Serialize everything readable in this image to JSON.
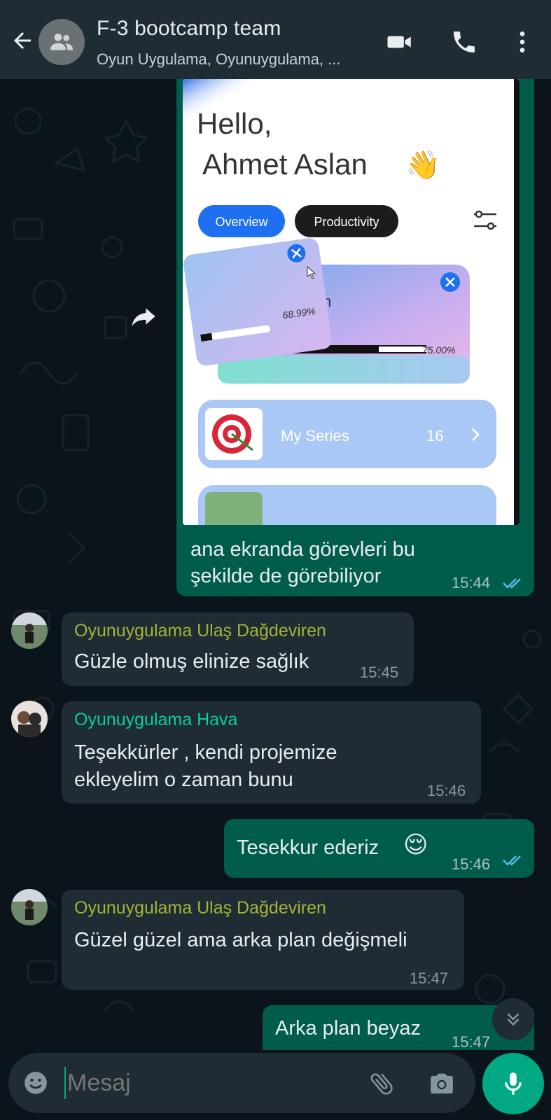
{
  "header": {
    "title": "F-3 bootcamp team",
    "subtitle": "Oyun Uygulama, Oyunuygulama, ..."
  },
  "messages": [
    {
      "type": "image",
      "direction": "out",
      "caption_line1": "ana ekranda görevleri bu",
      "caption_line2": "şekilde de görebiliyor",
      "time": "15:44",
      "image": {
        "greeting": "Hello,",
        "name": "Ahmet Aslan",
        "emoji": "👋",
        "tab_overview": "Overview",
        "tab_productivity": "Productivity",
        "card1_percent": "68.99%",
        "card2_percent": "75.00%",
        "card1_progress": 0.69,
        "card2_progress": 0.75,
        "card_partial_letter": "n",
        "series_label": "My Series",
        "series_count": "16"
      }
    },
    {
      "direction": "in",
      "sender": "Oyunuygulama Ulaş Dağdeviren",
      "text": "Güzle olmuş elinize sağlık",
      "time": "15:45"
    },
    {
      "direction": "in",
      "sender": "Oyunuygulama Hava",
      "line1": "Teşekkürler , kendi projemize",
      "line2": "ekleyelim o zaman bunu",
      "time": "15:46"
    },
    {
      "direction": "out",
      "text": "Tesekkur ederiz",
      "emoji": "😌",
      "time": "15:46"
    },
    {
      "direction": "in",
      "sender": "Oyunuygulama Ulaş Dağdeviren",
      "text": "Güzel güzel ama arka plan değişmeli",
      "time": "15:47"
    },
    {
      "direction": "out",
      "text": "Arka plan beyaz",
      "time": "15:47"
    }
  ],
  "input": {
    "placeholder": "Mesaj"
  },
  "colors": {
    "background": "#0b141a",
    "header": "#1f2c34",
    "outgoing": "#005c4b",
    "incoming": "#1f2c34",
    "accent": "#00a884",
    "read_ticks": "#53bdeb",
    "sender_ulas": "#a5b337",
    "sender_hava": "#06cf9c"
  }
}
